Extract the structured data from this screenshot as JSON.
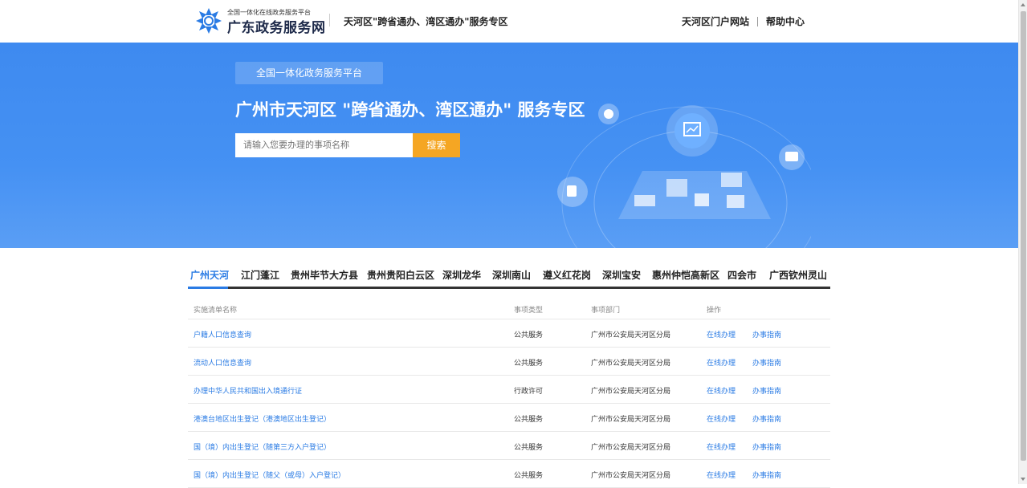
{
  "header": {
    "logo_subtitle": "全国一体化在线政务服务平台",
    "logo_title": "广东政务服务网",
    "zone_title": "天河区\"跨省通办、湾区通办\"服务专区",
    "links": [
      "天河区门户网站",
      "帮助中心"
    ]
  },
  "banner": {
    "tag": "全国一体化政务服务平台",
    "title": "广州市天河区 \"跨省通办、湾区通办\" 服务专区",
    "search_placeholder": "请输入您要办理的事项名称",
    "search_button": "搜索"
  },
  "tabs": [
    "广州天河",
    "江门蓬江",
    "贵州毕节大方县",
    "贵州贵阳白云区",
    "深圳龙华",
    "深圳南山",
    "遵义红花岗",
    "深圳宝安",
    "惠州仲恺高新区",
    "四会市",
    "广西钦州灵山"
  ],
  "active_tab": "广州天河",
  "table": {
    "headers": [
      "实施清单名称",
      "事项类型",
      "事项部门",
      "操作"
    ],
    "rows": [
      {
        "name": "户籍人口信息查询",
        "type": "公共服务",
        "dept": "广州市公安局天河区分局",
        "op1": "在线办理",
        "op2": "办事指南"
      },
      {
        "name": "流动人口信息查询",
        "type": "公共服务",
        "dept": "广州市公安局天河区分局",
        "op1": "在线办理",
        "op2": "办事指南"
      },
      {
        "name": "办理中华人民共和国出入境通行证",
        "type": "行政许可",
        "dept": "广州市公安局天河区分局",
        "op1": "在线办理",
        "op2": "办事指南"
      },
      {
        "name": "港澳台地区出生登记（港澳地区出生登记）",
        "type": "公共服务",
        "dept": "广州市公安局天河区分局",
        "op1": "在线办理",
        "op2": "办事指南"
      },
      {
        "name": "国（境）内出生登记（随第三方入户登记）",
        "type": "公共服务",
        "dept": "广州市公安局天河区分局",
        "op1": "在线办理",
        "op2": "办事指南"
      },
      {
        "name": "国（境）内出生登记（随父（或母）入户登记）",
        "type": "公共服务",
        "dept": "广州市公安局天河区分局",
        "op1": "在线办理",
        "op2": "办事指南"
      }
    ]
  },
  "colors": {
    "banner": "#4591f3",
    "accent": "#2a7be4",
    "search_button": "#f5a623"
  }
}
